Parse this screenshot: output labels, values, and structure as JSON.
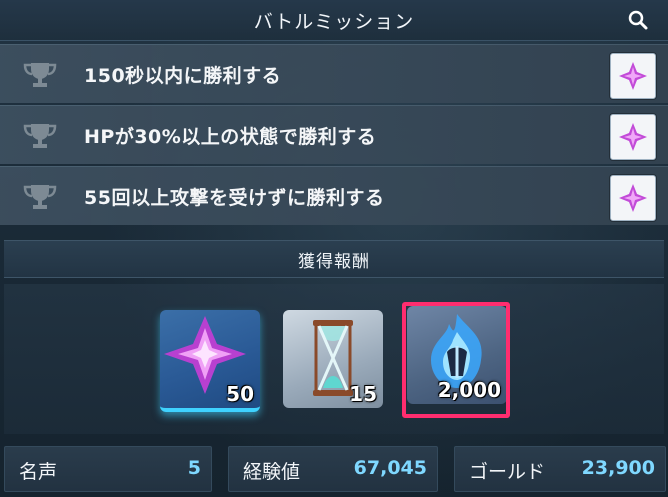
{
  "header": {
    "title": "バトルミッション",
    "search_icon": "search-icon"
  },
  "missions": [
    {
      "text": "150秒以内に勝利する",
      "icon": "trophy-icon",
      "reward_icon": "crystal-icon"
    },
    {
      "text": "HPが30%以上の状態で勝利する",
      "icon": "trophy-icon",
      "reward_icon": "crystal-icon"
    },
    {
      "text": "55回以上攻撃を受けずに勝利する",
      "icon": "trophy-icon",
      "reward_icon": "crystal-icon"
    }
  ],
  "rewards": {
    "title": "獲得報酬",
    "items": [
      {
        "name": "crystal",
        "count": "50"
      },
      {
        "name": "hourglass",
        "count": "15"
      },
      {
        "name": "blue-flame",
        "count": "2,000"
      }
    ]
  },
  "stats": {
    "fame": {
      "label": "名声",
      "value": "5"
    },
    "exp": {
      "label": "経験値",
      "value": "67,045"
    },
    "gold": {
      "label": "ゴールド",
      "value": "23,900"
    }
  },
  "colors": {
    "highlight": "#ff2d6f",
    "stat_value": "#7fd8ff",
    "crystal": "#d24fe0"
  }
}
